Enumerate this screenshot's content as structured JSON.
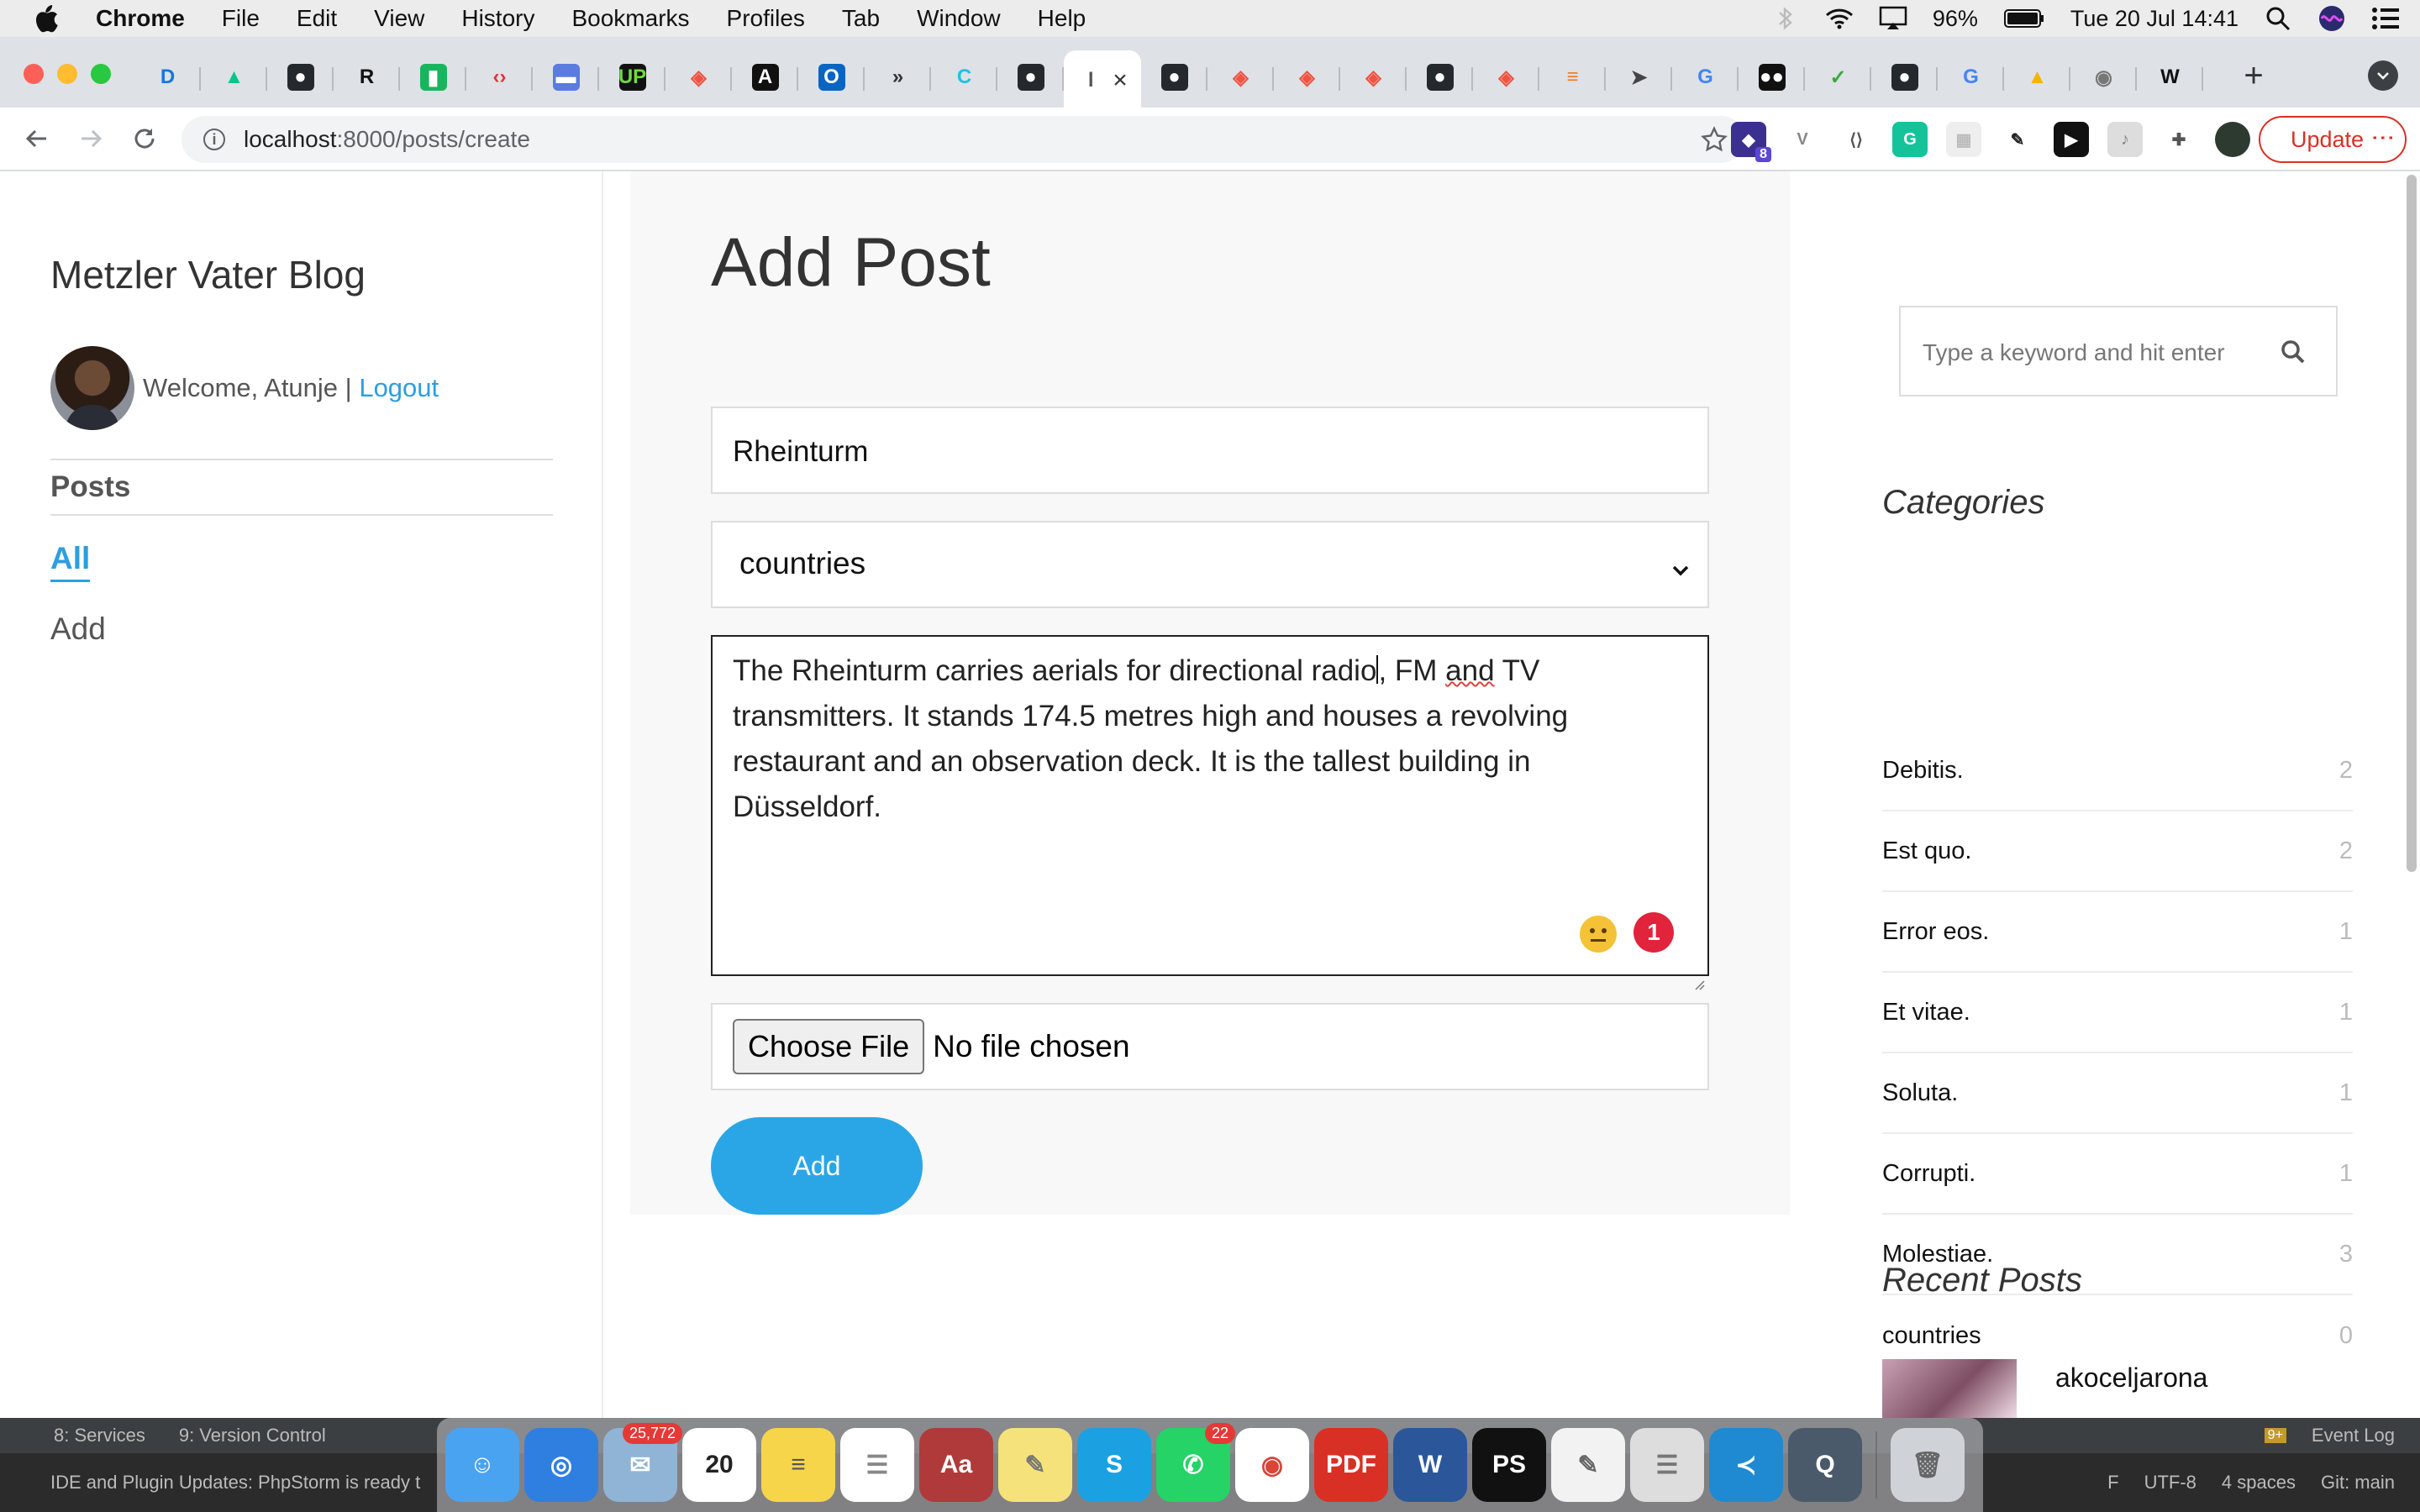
{
  "menubar": {
    "app": "Chrome",
    "items": [
      "File",
      "Edit",
      "View",
      "History",
      "Bookmarks",
      "Profiles",
      "Tab",
      "Window",
      "Help"
    ],
    "battery": "96%",
    "clock": "Tue 20 Jul  14:41"
  },
  "tabs": [
    {
      "icon": "d-icon",
      "glyph": "D",
      "color": "#ffffff",
      "fg": "#1a73e8"
    },
    {
      "icon": "nuxt-icon",
      "glyph": "▲",
      "color": "#ffffff",
      "fg": "#00c58e"
    },
    {
      "icon": "github-icon",
      "glyph": "●",
      "color": "#24292e"
    },
    {
      "icon": "r-icon",
      "glyph": "R",
      "color": "#ffffff",
      "fg": "#111111"
    },
    {
      "icon": "tool-icon",
      "glyph": "▮",
      "color": "#19b55e"
    },
    {
      "icon": "code-icon",
      "glyph": "‹›",
      "color": "#ffffff",
      "fg": "#d33"
    },
    {
      "icon": "card-icon",
      "glyph": "▬",
      "color": "#5a7be0"
    },
    {
      "icon": "upwork-icon",
      "glyph": "UP",
      "color": "#111111",
      "fg": "#6fda44"
    },
    {
      "icon": "laravel-icon",
      "glyph": "◈",
      "color": "#ffffff",
      "fg": "#f05340"
    },
    {
      "icon": "a-icon",
      "glyph": "A",
      "color": "#111111"
    },
    {
      "icon": "outlook-icon",
      "glyph": "O",
      "color": "#0a64c2"
    },
    {
      "icon": "chevrons-icon",
      "glyph": "»",
      "color": "#ffffff",
      "fg": "#333"
    },
    {
      "icon": "c-icon",
      "glyph": "C",
      "color": "#ffffff",
      "fg": "#1ec3e0"
    },
    {
      "icon": "github-icon",
      "glyph": "●",
      "color": "#24292e"
    },
    {
      "icon": "localhost-icon",
      "glyph": "l",
      "color": "#ffffff",
      "fg": "#555",
      "active": true
    },
    {
      "icon": "github-icon",
      "glyph": "●",
      "color": "#24292e"
    },
    {
      "icon": "laravel-icon",
      "glyph": "◈",
      "color": "#ffffff",
      "fg": "#f05340"
    },
    {
      "icon": "laravel-icon",
      "glyph": "◈",
      "color": "#ffffff",
      "fg": "#f05340"
    },
    {
      "icon": "laravel-icon",
      "glyph": "◈",
      "color": "#ffffff",
      "fg": "#f05340"
    },
    {
      "icon": "github-icon",
      "glyph": "●",
      "color": "#24292e"
    },
    {
      "icon": "laravel-icon",
      "glyph": "◈",
      "color": "#ffffff",
      "fg": "#f05340"
    },
    {
      "icon": "stackoverflow-icon",
      "glyph": "≡",
      "color": "#ffffff",
      "fg": "#f48024"
    },
    {
      "icon": "send-icon",
      "glyph": "➤",
      "color": "#ffffff",
      "fg": "#444"
    },
    {
      "icon": "google-icon",
      "glyph": "G",
      "color": "#ffffff",
      "fg": "#4285f4"
    },
    {
      "icon": "medium-icon",
      "glyph": "●●",
      "color": "#111111"
    },
    {
      "icon": "shield-icon",
      "glyph": "✓",
      "color": "#ffffff",
      "fg": "#3aa83a"
    },
    {
      "icon": "github-icon",
      "glyph": "●",
      "color": "#24292e"
    },
    {
      "icon": "google-icon",
      "glyph": "G",
      "color": "#ffffff",
      "fg": "#4285f4"
    },
    {
      "icon": "drive-icon",
      "glyph": "▲",
      "color": "#ffffff",
      "fg": "#f4b400"
    },
    {
      "icon": "camera-icon",
      "glyph": "◉",
      "color": "#ffffff",
      "fg": "#777"
    },
    {
      "icon": "wikipedia-icon",
      "glyph": "W",
      "color": "#ffffff",
      "fg": "#111"
    }
  ],
  "address": {
    "host": "localhost",
    "path": ":8000/posts/create"
  },
  "extensions": [
    {
      "name": "extension-badge-icon",
      "color": "#3b2f8f",
      "glyph": "◆",
      "badge": "8"
    },
    {
      "name": "vuejs-devtools-icon",
      "color": "#ffffff",
      "glyph": "V",
      "fg": "#888"
    },
    {
      "name": "code-ext-icon",
      "color": "#ffffff",
      "glyph": "⟨⟩",
      "fg": "#555"
    },
    {
      "name": "grammarly-icon",
      "color": "#15c39a",
      "glyph": "G"
    },
    {
      "name": "grid-ext-icon",
      "color": "#eeeeee",
      "glyph": "▦",
      "fg": "#bbb"
    },
    {
      "name": "pencil-icon",
      "color": "#ffffff",
      "glyph": "✎",
      "fg": "#222"
    },
    {
      "name": "play-icon",
      "color": "#111111",
      "glyph": "▶"
    },
    {
      "name": "music-icon",
      "color": "#dddddd",
      "glyph": "♪",
      "fg": "#888"
    },
    {
      "name": "puzzle-icon",
      "color": "#ffffff",
      "glyph": "✚",
      "fg": "#555"
    },
    {
      "name": "profile-avatar-icon",
      "color": "#2d3a2f",
      "glyph": ""
    }
  ],
  "update_label": "Update",
  "blog": {
    "title": "Metzler Vater Blog",
    "welcome": "Welcome, Atunje | ",
    "logout": "Logout",
    "nav_heading": "Posts",
    "nav_all": "All",
    "nav_add": "Add"
  },
  "form": {
    "heading": "Add Post",
    "title_value": "Rheinturm",
    "category_value": "countries",
    "body_line1a": "The Rheinturm carries aerials for directional radio",
    "body_line1b": ", FM ",
    "body_line1c": "and",
    "body_line1d": " TV",
    "body_rest": "transmitters. It stands 174.5 metres high and houses a revolving restaurant and an observation deck. It is the tallest building in Düsseldorf.",
    "grammar_count": "1",
    "choose_file": "Choose File",
    "no_file": "No file chosen",
    "submit": "Add"
  },
  "sidebar": {
    "search_placeholder": "Type a keyword and hit enter",
    "categories_heading": "Categories",
    "categories": [
      {
        "name": "Debitis.",
        "count": "2"
      },
      {
        "name": "Est quo.",
        "count": "2"
      },
      {
        "name": "Error eos.",
        "count": "1"
      },
      {
        "name": "Et vitae.",
        "count": "1"
      },
      {
        "name": "Soluta.",
        "count": "1"
      },
      {
        "name": "Corrupti.",
        "count": "1"
      },
      {
        "name": "Molestiae.",
        "count": "3"
      },
      {
        "name": "countries",
        "count": "0"
      }
    ],
    "recent_heading": "Recent Posts",
    "recent_first": "akoceljarona"
  },
  "ide": {
    "services": "8: Services",
    "version_control": "9: Version Control",
    "notification": "IDE and Plugin Updates: PhpStorm is ready t",
    "event_log": "Event Log",
    "event_badge": "9+",
    "encoding": "UTF-8",
    "indent": "4 spaces",
    "git": "Git: main",
    "lf": "F"
  },
  "dock": [
    {
      "name": "finder-icon",
      "color": "#4aa3f0",
      "glyph": "☺"
    },
    {
      "name": "safari-icon",
      "color": "#2f7fe0",
      "glyph": "◎"
    },
    {
      "name": "mail-icon",
      "color": "#8fb4d6",
      "glyph": "✉",
      "badge": "25,772"
    },
    {
      "name": "calendar-icon",
      "color": "#ffffff",
      "glyph": "20",
      "fg": "#222"
    },
    {
      "name": "notes-icon",
      "color": "#f7d54a",
      "glyph": "≡",
      "fg": "#555"
    },
    {
      "name": "reminders-icon",
      "color": "#ffffff",
      "glyph": "☰",
      "fg": "#888"
    },
    {
      "name": "dictionary-icon",
      "color": "#b03a3a",
      "glyph": "Aa"
    },
    {
      "name": "stickies-icon",
      "color": "#f6e27a",
      "glyph": "✎",
      "fg": "#777"
    },
    {
      "name": "skype-icon",
      "color": "#1ba1e2",
      "glyph": "S"
    },
    {
      "name": "whatsapp-icon",
      "color": "#25d366",
      "glyph": "✆",
      "badge": "22"
    },
    {
      "name": "chrome-icon",
      "color": "#ffffff",
      "glyph": "◉",
      "fg": "#db4437"
    },
    {
      "name": "pdf-icon",
      "color": "#d93025",
      "glyph": "PDF"
    },
    {
      "name": "word-icon",
      "color": "#2b579a",
      "glyph": "W"
    },
    {
      "name": "phpstorm-icon",
      "color": "#111111",
      "glyph": "PS"
    },
    {
      "name": "textedit-icon",
      "color": "#f2f2f2",
      "glyph": "✎",
      "fg": "#666"
    },
    {
      "name": "sequel-icon",
      "color": "#dddddd",
      "glyph": "☰",
      "fg": "#777"
    },
    {
      "name": "vscode-icon",
      "color": "#1f8ad2",
      "glyph": "≺"
    },
    {
      "name": "quicktime-icon",
      "color": "#4a5a6a",
      "glyph": "Q"
    },
    {
      "name": "trash-icon",
      "color": "#cfd3d8",
      "glyph": "🗑",
      "fg": "#666"
    }
  ]
}
